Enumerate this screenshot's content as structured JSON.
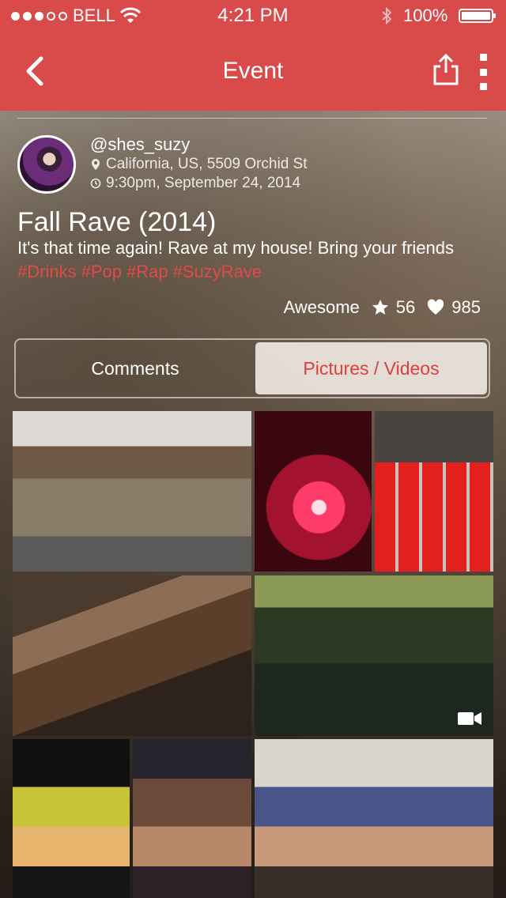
{
  "status_bar": {
    "carrier": "BELL",
    "time": "4:21 PM",
    "battery": "100%"
  },
  "nav": {
    "title": "Event",
    "back_icon": "chevron-left-icon",
    "share_icon": "share-icon",
    "more_icon": "more-vertical-icon"
  },
  "event": {
    "username": "@shes_suzy",
    "location": "California, US, 5509 Orchid St",
    "datetime": "9:30pm, September 24, 2014",
    "title": "Fall Rave (2014)",
    "description": "It's that time again! Rave at my house! Bring your friends",
    "tags": [
      "#Drinks",
      "#Pop",
      "#Rap",
      "#SuzyRave"
    ],
    "rating_label": "Awesome",
    "stars": "56",
    "likes": "985"
  },
  "tabs": {
    "comments": "Comments",
    "media": "Pictures / Videos",
    "active": "media"
  },
  "colors": {
    "accent": "#d94a4b",
    "tag": "#e24a48"
  }
}
